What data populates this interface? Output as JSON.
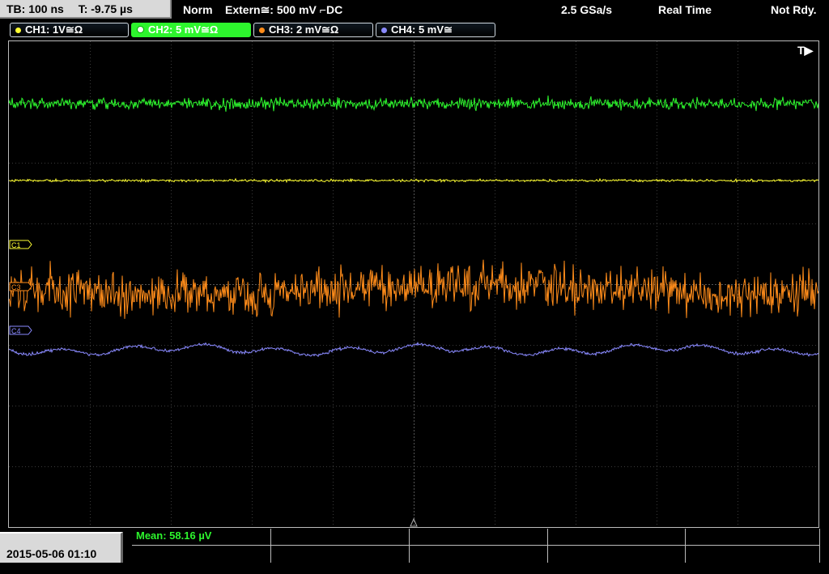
{
  "topbar": {
    "timebase": "TB: 100 ns",
    "trigger_time": "T: -9.75 µs",
    "mode": "Norm",
    "trigger_source": "Extern≅: 500 mV ⌐DC",
    "sample_rate": "2.5 GSa/s",
    "acq_mode": "Real Time",
    "status": "Not Rdy."
  },
  "channels": [
    {
      "label": "CH1: 1V≅Ω",
      "color": "#ffff33"
    },
    {
      "label": "CH2: 5 mV≅Ω",
      "color": "#2df52d"
    },
    {
      "label": "CH3: 2 mV≅Ω",
      "color": "#ff8c1a"
    },
    {
      "label": "CH4: 5 mV≅",
      "color": "#8a8aff"
    }
  ],
  "markers": {
    "c1": "C1",
    "c3": "C3",
    "c4": "C4",
    "trigger": "T▶"
  },
  "footer": {
    "datetime": "2015-05-06 01:10",
    "mean": "Mean: 58.16 µV"
  }
}
